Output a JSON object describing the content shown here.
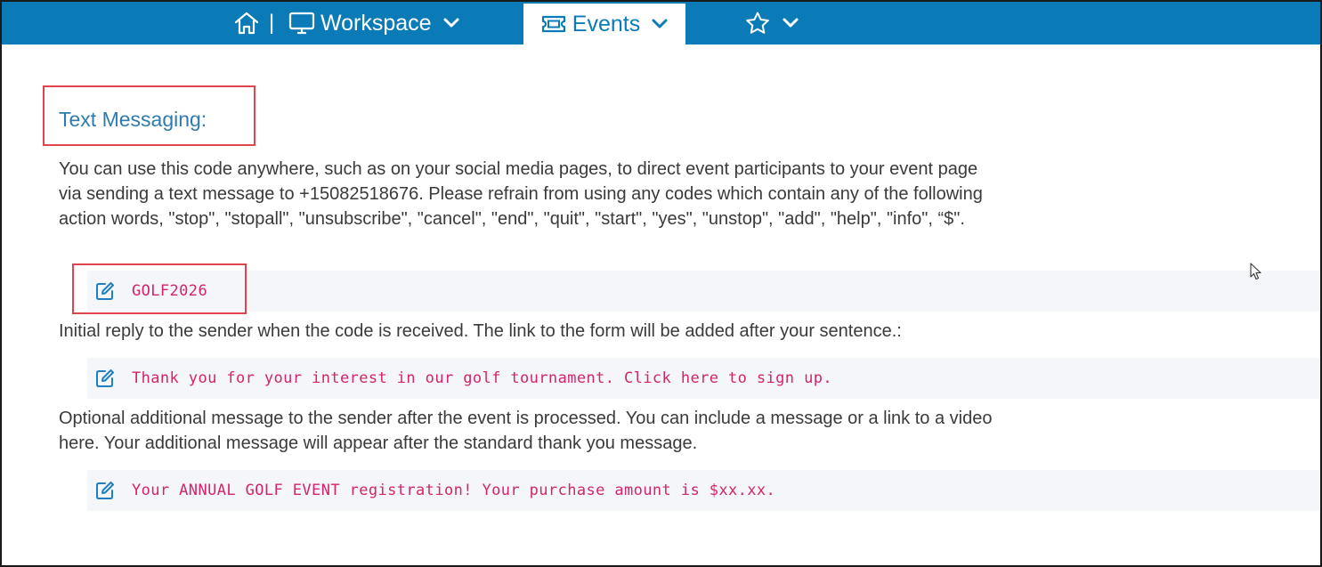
{
  "nav": {
    "workspace_label": "Workspace",
    "events_label": "Events",
    "separator": "|"
  },
  "section": {
    "title": "Text Messaging:",
    "description": "You can use this code anywhere, such as on your social media pages, to direct event participants to your event page via sending a text message to +15082518676. Please refrain from using any codes which contain any of the following action words, \"stop\", \"stopall\", \"unsubscribe\", \"cancel\", \"end\", \"quit\", \"start\", \"yes\", \"unstop\", \"add\", \"help\", \"info\", “$\".",
    "code_value": "GOLF2026",
    "initial_reply_label": "Initial reply to the sender when the code is received. The link to the form will be added after your sentence.:",
    "initial_reply_value": "Thank you for your interest in our golf tournament. Click here to sign up.",
    "additional_label": "Optional additional message to the sender after the event is processed. You can include a message or a link to a video here. Your additional message will appear after the standard thank you message.",
    "additional_value": "Your ANNUAL GOLF EVENT registration! Your purchase amount is $xx.xx."
  },
  "colors": {
    "nav_background": "#0b7bb8",
    "title": "#2f7bad",
    "code_text": "#d4246d",
    "highlight_border": "#e0454e",
    "field_background": "#f4f6f9"
  },
  "icons": {
    "home": "home-icon",
    "workspace": "monitor-icon",
    "events": "ticket-icon",
    "favorites": "star-icon",
    "edit": "edit-icon"
  }
}
